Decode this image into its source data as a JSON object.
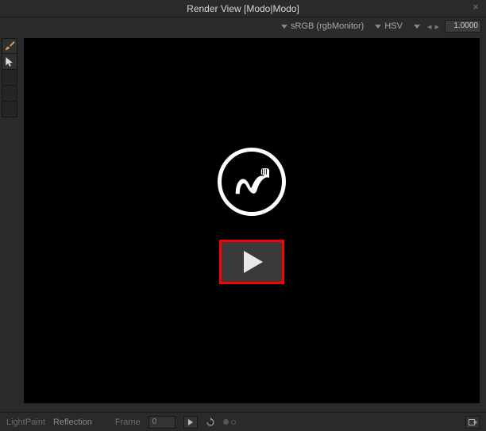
{
  "titlebar": {
    "title": "Render View [Modo|Modo]",
    "close_glyph": "×"
  },
  "optionbar": {
    "color_profile": "sRGB (rgbMonitor)",
    "color_model": "HSV",
    "exposure": "1.0000"
  },
  "left_tools": {
    "brush": "brush-tool",
    "cursor": "cursor-tool"
  },
  "viewport": {
    "logo_alt": "Modo logo"
  },
  "bottombar": {
    "mode_label": "LightPaint",
    "channel": "Reflection",
    "frame_label": "Frame",
    "frame_value": "0"
  }
}
